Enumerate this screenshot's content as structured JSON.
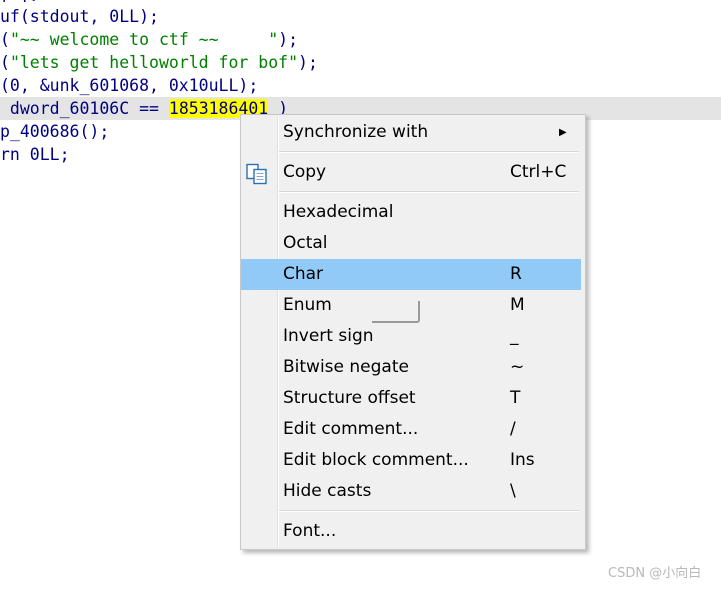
{
  "code": {
    "partial_top": "( );",
    "line1": "uf(stdout, 0LL);",
    "line2_prefix": "(",
    "line2_string": "\"~~ welcome to ctf ~~     \"",
    "line2_suffix": ");",
    "line3_prefix": "(",
    "line3_string": "\"lets get helloworld for bof\"",
    "line3_suffix": ");",
    "line4": "(0, &unk_601068, 0x10uLL);",
    "line5_prefix": " dword_60106C == ",
    "line5_highlight": "1853186401",
    "line5_suffix": " )",
    "line6": "p_400686();",
    "line7": "rn 0LL;"
  },
  "context_menu": {
    "synchronize": {
      "label": "Synchronize with",
      "submenu_icon": "triangle-right-icon"
    },
    "copy": {
      "label": "Copy",
      "shortcut": "Ctrl+C",
      "icon": "copy-icon"
    },
    "hexadecimal": {
      "label": "Hexadecimal"
    },
    "octal": {
      "label": "Octal"
    },
    "char": {
      "label": "Char",
      "shortcut": "R"
    },
    "enum": {
      "label": "Enum",
      "shortcut": "M"
    },
    "invert_sign": {
      "label": "Invert sign",
      "shortcut": "_"
    },
    "bitwise_negate": {
      "label": "Bitwise negate",
      "shortcut": "~"
    },
    "structure_offset": {
      "label": "Structure offset",
      "shortcut": "T"
    },
    "edit_comment": {
      "label": "Edit comment...",
      "shortcut": "/"
    },
    "edit_block_comment": {
      "label": "Edit block comment...",
      "shortcut": "Ins"
    },
    "hide_casts": {
      "label": "Hide casts",
      "shortcut": "\\"
    },
    "font": {
      "label": "Font..."
    }
  },
  "watermark": "CSDN @小向白",
  "colors": {
    "code_text": "#000080",
    "string_literal": "#008000",
    "number_highlight": "#ffff00",
    "current_line": "#e4e4e4",
    "menu_background": "#f0f0f0",
    "menu_selection": "#91c9f7"
  }
}
